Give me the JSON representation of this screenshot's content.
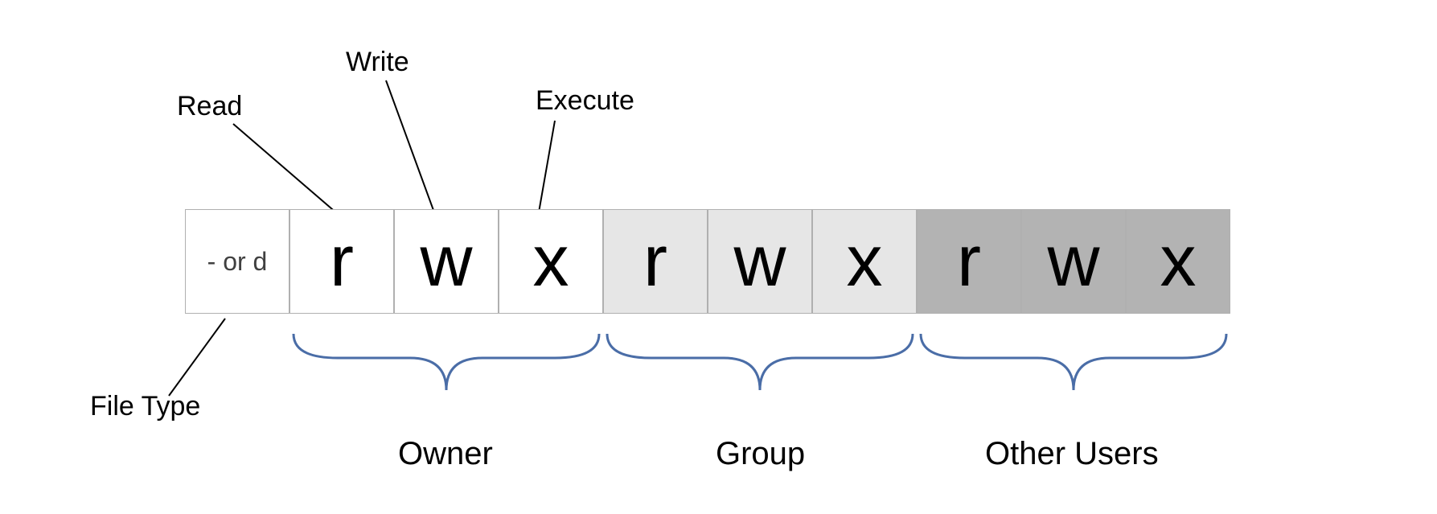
{
  "top_labels": {
    "read": "Read",
    "write": "Write",
    "execute": "Execute"
  },
  "side_label": {
    "file_type": "File Type"
  },
  "cells": {
    "type": "- or d",
    "owner_r": "r",
    "owner_w": "w",
    "owner_x": "x",
    "group_r": "r",
    "group_w": "w",
    "group_x": "x",
    "other_r": "r",
    "other_w": "w",
    "other_x": "x"
  },
  "groups": {
    "owner": "Owner",
    "group": "Group",
    "other": "Other Users"
  }
}
